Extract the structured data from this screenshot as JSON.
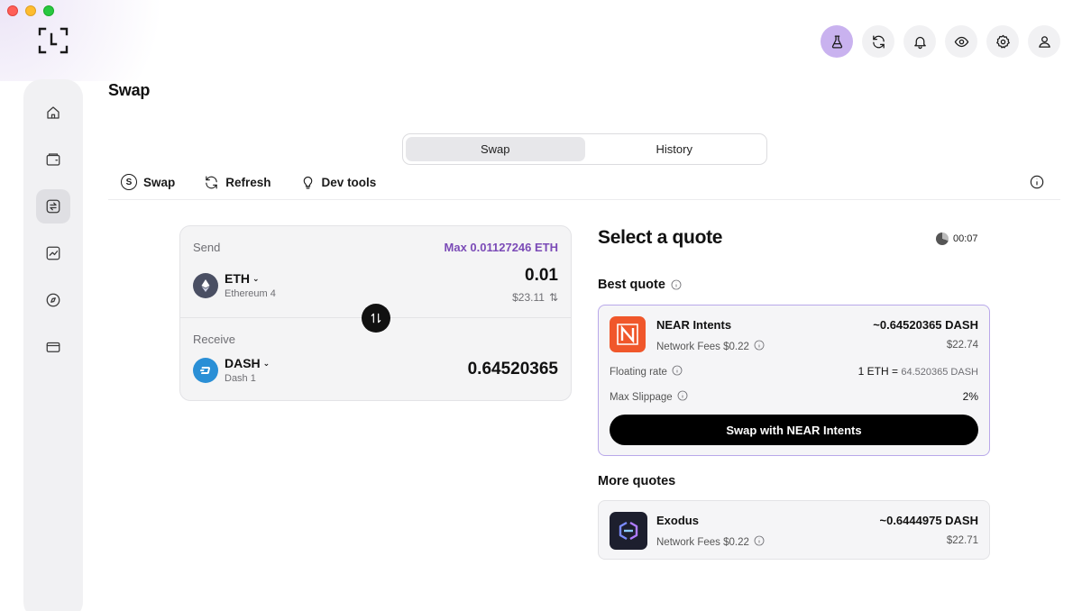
{
  "header": {
    "page_title": "Swap"
  },
  "tabs": [
    {
      "label": "Swap",
      "active": true
    },
    {
      "label": "History",
      "active": false
    }
  ],
  "toolbar": {
    "swap_label": "Swap",
    "swap_badge": "S",
    "refresh_label": "Refresh",
    "devtools_label": "Dev tools"
  },
  "send": {
    "label": "Send",
    "max": "Max 0.01127246 ETH",
    "asset": "ETH",
    "network": "Ethereum 4",
    "amount": "0.01",
    "fiat": "$23.11"
  },
  "receive": {
    "label": "Receive",
    "asset": "DASH",
    "network": "Dash 1",
    "amount": "0.64520365"
  },
  "quotes": {
    "title": "Select a quote",
    "timer": "00:07",
    "best_label": "Best quote",
    "more_label": "More quotes",
    "best": {
      "name": "NEAR Intents",
      "fees": "Network Fees $0.22",
      "amount": "~0.64520365 DASH",
      "usd": "$22.74",
      "rate_label": "Floating rate",
      "rate_value_left": "1 ETH =",
      "rate_value_right": "64.520365 DASH",
      "slippage_label": "Max Slippage",
      "slippage_value": "2%",
      "cta": "Swap with NEAR Intents"
    },
    "more": [
      {
        "name": "Exodus",
        "fees": "Network Fees $0.22",
        "amount": "~0.6444975 DASH",
        "usd": "$22.71"
      }
    ]
  },
  "colors": {
    "accent": "#7b4bb7",
    "active_icon_bg": "#c9b2ef",
    "best_border": "#b9a8ea",
    "near_brand": "#f0572b",
    "eth": "#627eea",
    "dash": "#008de4"
  }
}
